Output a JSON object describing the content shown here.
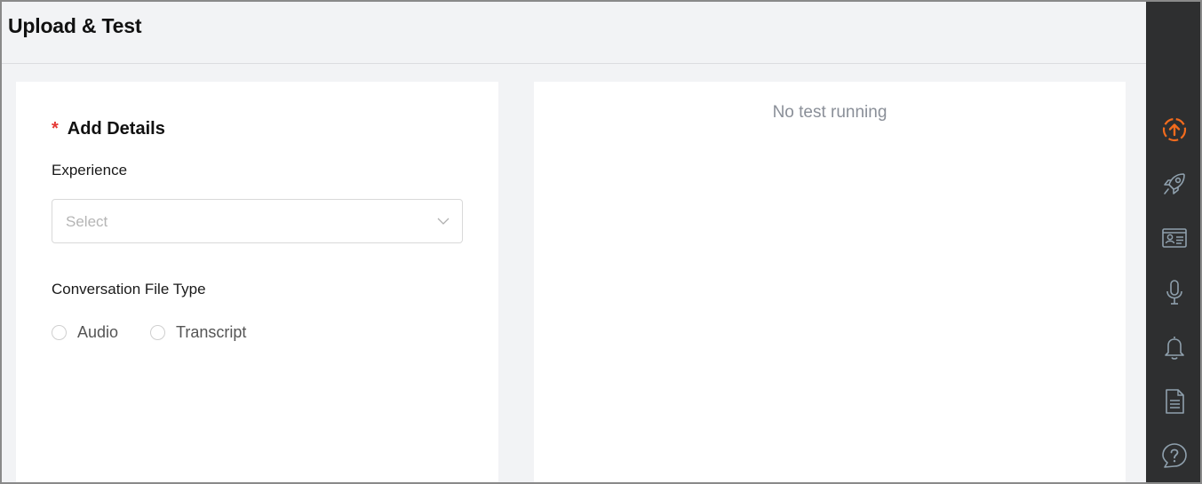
{
  "header": {
    "title": "Upload & Test"
  },
  "form": {
    "required_marker": "*",
    "section_title": "Add Details",
    "experience": {
      "label": "Experience",
      "placeholder": "Select"
    },
    "file_type": {
      "label": "Conversation File Type",
      "options": [
        {
          "label": "Audio",
          "selected": false
        },
        {
          "label": "Transcript",
          "selected": false
        }
      ]
    }
  },
  "results": {
    "status": "No test running"
  },
  "sidebar": {
    "items": [
      {
        "icon": "upload-icon",
        "active": true
      },
      {
        "icon": "rocket-icon",
        "active": false
      },
      {
        "icon": "id-card-icon",
        "active": false
      },
      {
        "icon": "microphone-icon",
        "active": false
      },
      {
        "icon": "bell-icon",
        "active": false
      },
      {
        "icon": "document-icon",
        "active": false
      },
      {
        "icon": "help-icon",
        "active": false
      }
    ]
  },
  "colors": {
    "accent": "#f26b1d",
    "required": "#e53935",
    "sidebar_bg": "#2e2f30",
    "sidebar_icon": "#8fa0ad"
  }
}
